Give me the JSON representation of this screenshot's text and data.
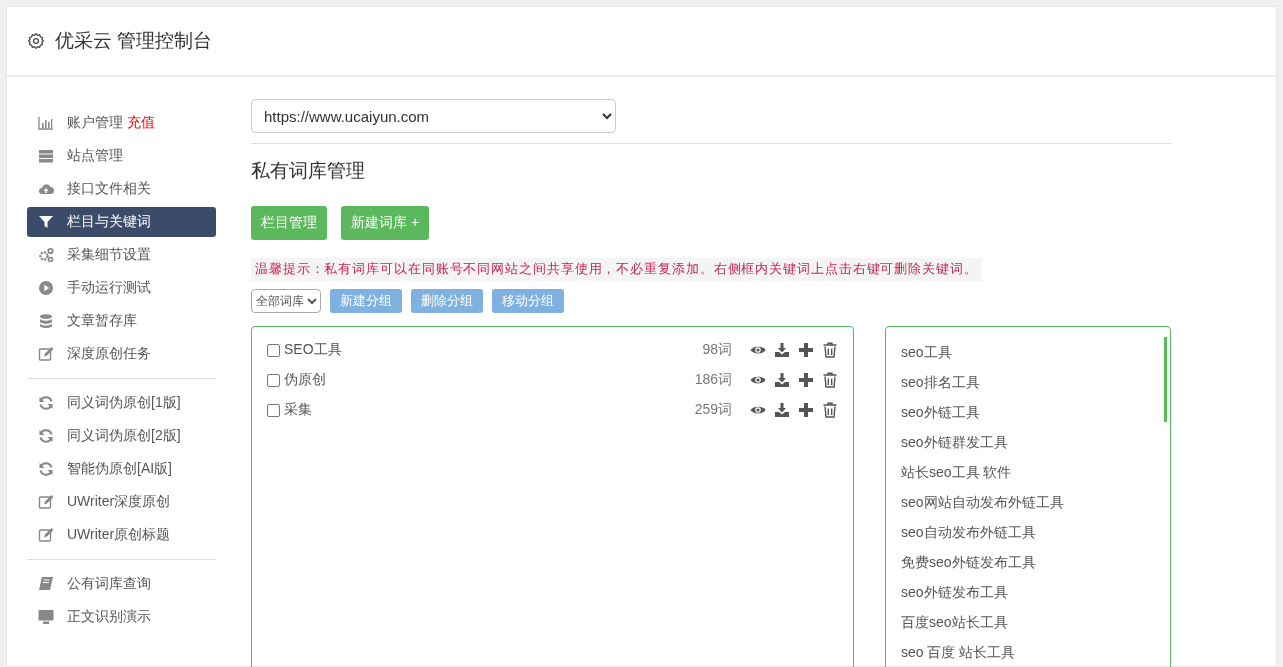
{
  "header": {
    "title": "优采云 管理控制台"
  },
  "sidebar": {
    "groups": [
      [
        {
          "label": "账户管理",
          "badge": "充值",
          "kind": "chart",
          "selected": false
        },
        {
          "label": "站点管理",
          "kind": "server",
          "selected": false
        },
        {
          "label": "接口文件相关",
          "kind": "cloud",
          "selected": false
        },
        {
          "label": "栏目与关键词",
          "kind": "filter",
          "selected": true
        },
        {
          "label": "采集细节设置",
          "kind": "gears",
          "selected": false
        },
        {
          "label": "手动运行测试",
          "kind": "play",
          "selected": false
        },
        {
          "label": "文章暂存库",
          "kind": "database",
          "selected": false
        },
        {
          "label": "深度原创任务",
          "kind": "edit",
          "selected": false
        }
      ],
      [
        {
          "label": "同义词伪原创[1版]",
          "kind": "refresh",
          "selected": false
        },
        {
          "label": "同义词伪原创[2版]",
          "kind": "refresh",
          "selected": false
        },
        {
          "label": "智能伪原创[AI版]",
          "kind": "refresh",
          "selected": false
        },
        {
          "label": "UWriter深度原创",
          "kind": "edit",
          "selected": false
        },
        {
          "label": "UWriter原创标题",
          "kind": "edit",
          "selected": false
        }
      ],
      [
        {
          "label": "公有词库查询",
          "kind": "book",
          "selected": false
        },
        {
          "label": "正文识别演示",
          "kind": "monitor",
          "selected": false
        }
      ]
    ]
  },
  "site_select": {
    "value": "https://www.ucaiyun.com"
  },
  "heading": "私有词库管理",
  "buttons": [
    "栏目管理",
    "新建词库 +"
  ],
  "tip": "温馨提示：私有词库可以在同账号不同网站之间共享使用，不必重复添加。右侧框内关键词上点击右键可删除关键词。",
  "group_select": {
    "value": "全部词库"
  },
  "group_buttons": [
    "新建分组",
    "删除分组",
    "移动分组"
  ],
  "libraries": [
    {
      "name": "SEO工具",
      "count": "98词",
      "checked": false
    },
    {
      "name": "伪原创",
      "count": "186词",
      "checked": false
    },
    {
      "name": "采集",
      "count": "259词",
      "checked": false
    }
  ],
  "keywords": [
    "seo工具",
    "seo排名工具",
    "seo外链工具",
    "seo外链群发工具",
    "站长seo工具 软件",
    "seo网站自动发布外链工具",
    "seo自动发布外链工具",
    "免费seo外链发布工具",
    "seo外链发布工具",
    "百度seo站长工具",
    "seo 百度 站长工具"
  ]
}
